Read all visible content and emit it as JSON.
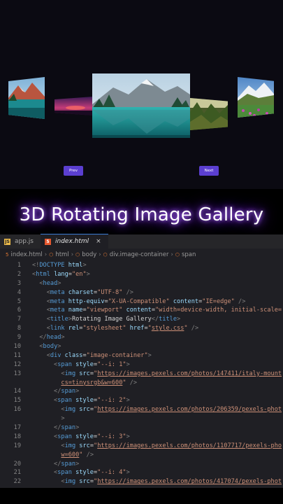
{
  "gallery": {
    "prev_label": "Prev",
    "next_label": "Next"
  },
  "heading": "3D Rotating Image Gallery",
  "editor": {
    "tabs": [
      {
        "label": "app.js",
        "icon": "js-file-icon"
      },
      {
        "label": "index.html",
        "icon": "html5-file-icon",
        "active": true
      }
    ],
    "breadcrumb": [
      "index.html",
      "html",
      "body",
      "div.image-container",
      "span"
    ],
    "lines": [
      {
        "n": "1",
        "tokens": [
          [
            "b",
            "<!"
          ],
          [
            "t",
            "DOCTYPE"
          ],
          [
            "a",
            " html"
          ],
          [
            "b",
            ">"
          ]
        ]
      },
      {
        "n": "2",
        "tokens": [
          [
            "b",
            "<"
          ],
          [
            "t",
            "html"
          ],
          [
            "a",
            " lang"
          ],
          [
            "w",
            "="
          ],
          [
            "s",
            "\"en\""
          ],
          [
            "b",
            ">"
          ]
        ]
      },
      {
        "n": "3",
        "tokens": [
          [
            "w",
            "  "
          ],
          [
            "b",
            "<"
          ],
          [
            "t",
            "head"
          ],
          [
            "b",
            ">"
          ]
        ]
      },
      {
        "n": "4",
        "tokens": [
          [
            "w",
            "    "
          ],
          [
            "b",
            "<"
          ],
          [
            "t",
            "meta"
          ],
          [
            "a",
            " charset"
          ],
          [
            "w",
            "="
          ],
          [
            "s",
            "\"UTF-8\""
          ],
          [
            "w",
            " "
          ],
          [
            "b",
            "/>"
          ]
        ]
      },
      {
        "n": "5",
        "tokens": [
          [
            "w",
            "    "
          ],
          [
            "b",
            "<"
          ],
          [
            "t",
            "meta"
          ],
          [
            "a",
            " http-equiv"
          ],
          [
            "w",
            "="
          ],
          [
            "s",
            "\"X-UA-Compatible\""
          ],
          [
            "a",
            " content"
          ],
          [
            "w",
            "="
          ],
          [
            "s",
            "\"IE=edge\""
          ],
          [
            "w",
            " "
          ],
          [
            "b",
            "/>"
          ]
        ]
      },
      {
        "n": "6",
        "tokens": [
          [
            "w",
            "    "
          ],
          [
            "b",
            "<"
          ],
          [
            "t",
            "meta"
          ],
          [
            "a",
            " name"
          ],
          [
            "w",
            "="
          ],
          [
            "s",
            "\"viewport\""
          ],
          [
            "a",
            " content"
          ],
          [
            "w",
            "="
          ],
          [
            "s",
            "\"width=device-width, initial-scale="
          ]
        ]
      },
      {
        "n": "7",
        "tokens": [
          [
            "w",
            "    "
          ],
          [
            "b",
            "<"
          ],
          [
            "t",
            "title"
          ],
          [
            "b",
            ">"
          ],
          [
            "w",
            "Rotating Image Gallery"
          ],
          [
            "b",
            "</"
          ],
          [
            "t",
            "title"
          ],
          [
            "b",
            ">"
          ]
        ]
      },
      {
        "n": "8",
        "tokens": [
          [
            "w",
            "    "
          ],
          [
            "b",
            "<"
          ],
          [
            "t",
            "link"
          ],
          [
            "a",
            " rel"
          ],
          [
            "w",
            "="
          ],
          [
            "s",
            "\"stylesheet\""
          ],
          [
            "a",
            " href"
          ],
          [
            "w",
            "="
          ],
          [
            "s",
            "\""
          ],
          [
            "u",
            "style.css"
          ],
          [
            "s",
            "\""
          ],
          [
            "w",
            " "
          ],
          [
            "b",
            "/>"
          ]
        ]
      },
      {
        "n": "9",
        "tokens": [
          [
            "w",
            "  "
          ],
          [
            "b",
            "</"
          ],
          [
            "t",
            "head"
          ],
          [
            "b",
            ">"
          ]
        ]
      },
      {
        "n": "10",
        "tokens": [
          [
            "w",
            "  "
          ],
          [
            "b",
            "<"
          ],
          [
            "t",
            "body"
          ],
          [
            "b",
            ">"
          ]
        ]
      },
      {
        "n": "11",
        "tokens": [
          [
            "w",
            "    "
          ],
          [
            "b",
            "<"
          ],
          [
            "t",
            "div"
          ],
          [
            "a",
            " class"
          ],
          [
            "w",
            "="
          ],
          [
            "s",
            "\"image-container\""
          ],
          [
            "b",
            ">"
          ]
        ]
      },
      {
        "n": "12",
        "tokens": [
          [
            "w",
            "      "
          ],
          [
            "b",
            "<"
          ],
          [
            "t",
            "span"
          ],
          [
            "a",
            " style"
          ],
          [
            "w",
            "="
          ],
          [
            "s",
            "\"--i: 1\""
          ],
          [
            "b",
            ">"
          ]
        ]
      },
      {
        "n": "13",
        "tokens": [
          [
            "w",
            "        "
          ],
          [
            "b",
            "<"
          ],
          [
            "t",
            "img"
          ],
          [
            "a",
            " src"
          ],
          [
            "w",
            "="
          ],
          [
            "s",
            "\""
          ],
          [
            "u",
            "https://images.pexels.com/photos/147411/italy-mount"
          ]
        ]
      },
      {
        "n": "",
        "tokens": [
          [
            "w",
            "        "
          ],
          [
            "u",
            "cs=tinysrgb&w=600"
          ],
          [
            "s",
            "\""
          ],
          [
            "w",
            " "
          ],
          [
            "b",
            "/>"
          ]
        ]
      },
      {
        "n": "14",
        "tokens": [
          [
            "w",
            "      "
          ],
          [
            "b",
            "</"
          ],
          [
            "t",
            "span"
          ],
          [
            "b",
            ">"
          ]
        ]
      },
      {
        "n": "15",
        "tokens": [
          [
            "w",
            "      "
          ],
          [
            "b",
            "<"
          ],
          [
            "t",
            "span"
          ],
          [
            "a",
            " style"
          ],
          [
            "w",
            "="
          ],
          [
            "s",
            "\"--i: 2\""
          ],
          [
            "b",
            ">"
          ]
        ]
      },
      {
        "n": "16",
        "tokens": [
          [
            "w",
            "        "
          ],
          [
            "b",
            "<"
          ],
          [
            "t",
            "img"
          ],
          [
            "a",
            " src"
          ],
          [
            "w",
            "="
          ],
          [
            "s",
            "\""
          ],
          [
            "u",
            "https://images.pexels.com/photos/206359/pexels-phot"
          ]
        ]
      },
      {
        "n": "",
        "tokens": [
          [
            "w",
            "        "
          ],
          [
            "b",
            ">"
          ]
        ]
      },
      {
        "n": "17",
        "tokens": [
          [
            "w",
            "      "
          ],
          [
            "b",
            "</"
          ],
          [
            "t",
            "span"
          ],
          [
            "b",
            ">"
          ]
        ]
      },
      {
        "n": "18",
        "tokens": [
          [
            "w",
            "      "
          ],
          [
            "b",
            "<"
          ],
          [
            "t",
            "span"
          ],
          [
            "a",
            " style"
          ],
          [
            "w",
            "="
          ],
          [
            "s",
            "\"--i: 3\""
          ],
          [
            "b",
            ">"
          ]
        ]
      },
      {
        "n": "19",
        "tokens": [
          [
            "w",
            "        "
          ],
          [
            "b",
            "<"
          ],
          [
            "t",
            "img"
          ],
          [
            "a",
            " src"
          ],
          [
            "w",
            "="
          ],
          [
            "s",
            "\""
          ],
          [
            "u",
            "https://images.pexels.com/photos/1107717/pexels-pho"
          ]
        ]
      },
      {
        "n": "",
        "tokens": [
          [
            "w",
            "        "
          ],
          [
            "u",
            "w=600"
          ],
          [
            "s",
            "\""
          ],
          [
            "w",
            " "
          ],
          [
            "b",
            "/>"
          ]
        ]
      },
      {
        "n": "20",
        "tokens": [
          [
            "w",
            "      "
          ],
          [
            "b",
            "</"
          ],
          [
            "t",
            "span"
          ],
          [
            "b",
            ">"
          ]
        ]
      },
      {
        "n": "21",
        "tokens": [
          [
            "w",
            "      "
          ],
          [
            "b",
            "<"
          ],
          [
            "t",
            "span"
          ],
          [
            "a",
            " style"
          ],
          [
            "w",
            "="
          ],
          [
            "s",
            "\"--i: 4\""
          ],
          [
            "b",
            ">"
          ]
        ]
      },
      {
        "n": "22",
        "tokens": [
          [
            "w",
            "        "
          ],
          [
            "b",
            "<"
          ],
          [
            "t",
            "img"
          ],
          [
            "a",
            " src"
          ],
          [
            "w",
            "="
          ],
          [
            "s",
            "\""
          ],
          [
            "u",
            "https://images.pexels.com/photos/417074/pexels-phot"
          ]
        ]
      }
    ]
  }
}
